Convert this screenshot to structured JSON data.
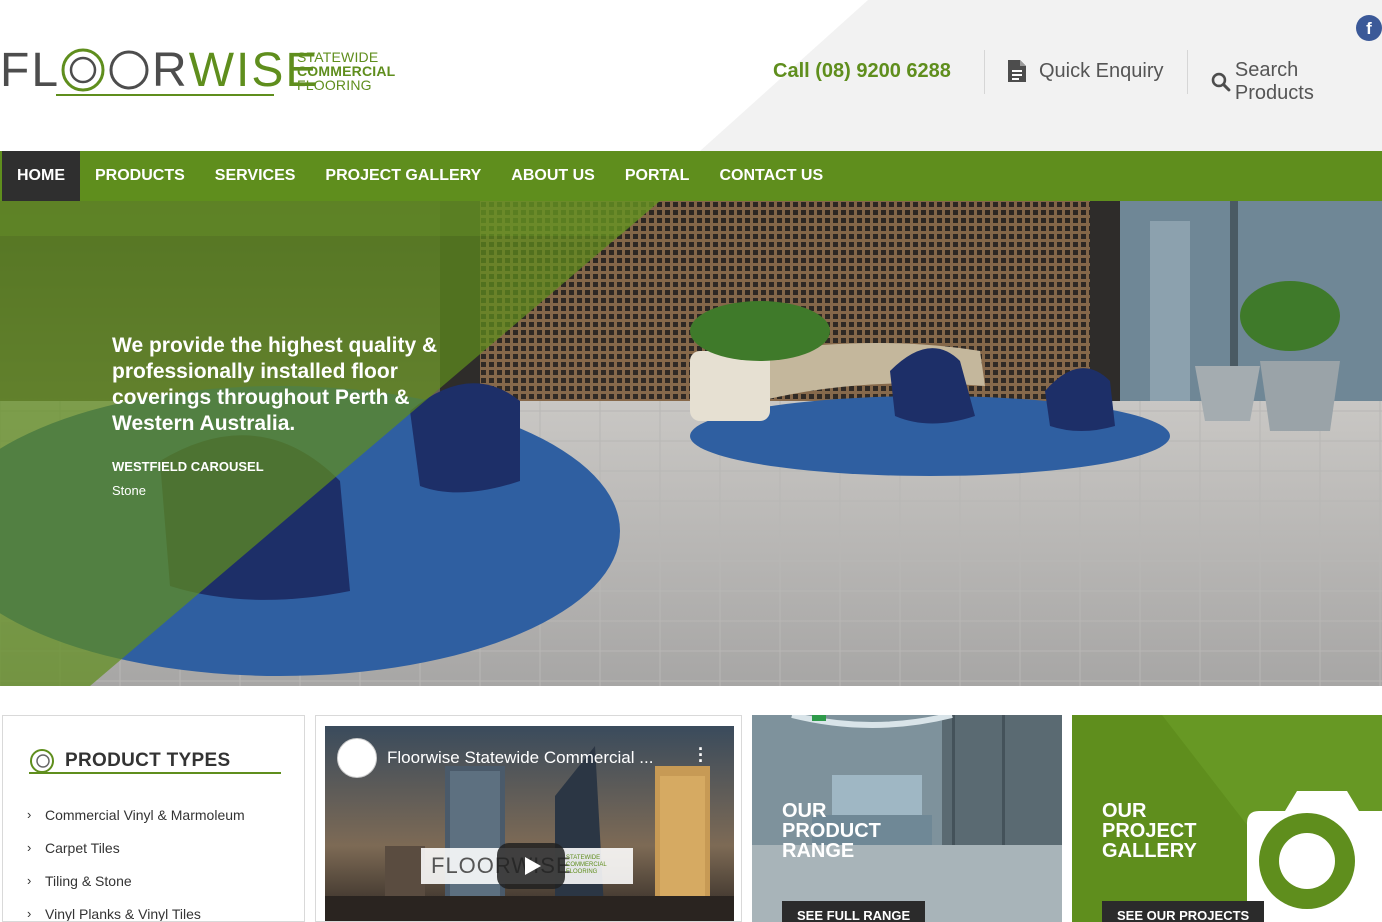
{
  "brand": {
    "logo_left": "FL",
    "logo_right": "RWISE",
    "logo_wise_split": "R",
    "tagline_1": "STATEWIDE",
    "tagline_2": "COMMERCIAL",
    "tagline_3": "FLOORING",
    "accent_color": "#5f8e1d",
    "dark_color": "#2f2f2f"
  },
  "header": {
    "social_icon": "facebook-icon",
    "social_label": "f",
    "call_label": "Call (08) 9200 6288",
    "enquiry_icon": "document-icon",
    "enquiry_label": "Quick Enquiry",
    "search_icon": "search-icon",
    "search_label": "Search Products"
  },
  "nav": {
    "items": [
      {
        "label": "HOME",
        "active": true
      },
      {
        "label": "PRODUCTS",
        "active": false
      },
      {
        "label": "SERVICES",
        "active": false
      },
      {
        "label": "PROJECT GALLERY",
        "active": false
      },
      {
        "label": "ABOUT US",
        "active": false
      },
      {
        "label": "PORTAL",
        "active": false
      },
      {
        "label": "CONTACT US",
        "active": false
      }
    ]
  },
  "hero": {
    "headline": "We provide the highest quality & professionally installed floor coverings throughout Perth & Western Australia.",
    "project_name": "WESTFIELD CAROUSEL",
    "material": "Stone"
  },
  "product_types": {
    "title": "PRODUCT TYPES",
    "icon": "floorwise-o-icon",
    "items": [
      "Commercial Vinyl & Marmoleum",
      "Carpet Tiles",
      "Tiling & Stone",
      "Vinyl Planks & Vinyl Tiles"
    ]
  },
  "video": {
    "title": "Floorwise Statewide Commercial ...",
    "logo_text": "FLOORWISE",
    "logo_tag_1": "STATEWIDE",
    "logo_tag_2": "COMMERCIAL",
    "logo_tag_3": "FLOORING",
    "play_icon": "play-icon",
    "menu_icon": "more-vertical-icon"
  },
  "tiles": {
    "range": {
      "title_1": "OUR",
      "title_2": "PRODUCT",
      "title_3": "RANGE",
      "button": "SEE FULL RANGE"
    },
    "gallery": {
      "title_1": "OUR",
      "title_2": "PROJECT",
      "title_3": "GALLERY",
      "button": "SEE OUR PROJECTS",
      "icon": "camera-icon"
    }
  }
}
